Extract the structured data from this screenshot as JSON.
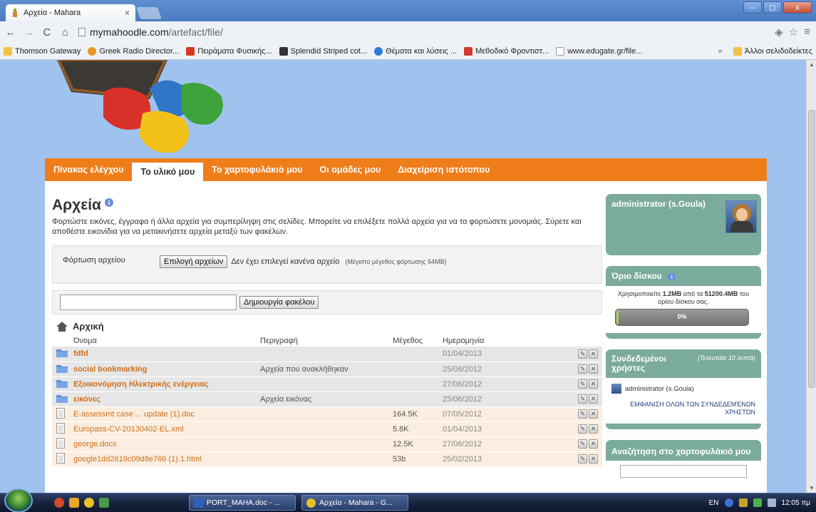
{
  "browser": {
    "tab_title": "Αρχεία - Mahara",
    "tab_close": "×",
    "url_host": "mymahoodle.com",
    "url_path": "/artefact/file/",
    "window_buttons": [
      "–",
      "◻",
      "x"
    ],
    "bookmarks": [
      {
        "label": "Thomson Gateway",
        "icon": "folder-icon",
        "color": "#f1c243"
      },
      {
        "label": "Greek Radio Director...",
        "icon": "radio-icon",
        "color": "#e8981f"
      },
      {
        "label": "Πειράματα Φυσικής...",
        "icon": "physics-icon",
        "color": "#d7381b"
      },
      {
        "label": "Splendid Striped cot...",
        "icon": "p-icon",
        "color": "#333333"
      },
      {
        "label": "Θέματα και λύσεις ...",
        "icon": "globe-icon",
        "color": "#2a7bd6"
      },
      {
        "label": "Μεθοδικό Φροντιστ...",
        "icon": "m-icon",
        "color": "#d43a2c"
      },
      {
        "label": "www.edugate.gr/file...",
        "icon": "page-icon",
        "color": "#ffffff"
      }
    ],
    "bookmarks_overflow": "»",
    "other_bookmarks": "Άλλοι σελιδοδείκτες"
  },
  "nav": {
    "items": [
      {
        "label": "Πίνακας ελέγχου",
        "active": false
      },
      {
        "label": "Το υλικό μου",
        "active": true
      },
      {
        "label": "Το χαρτοφυλάκιό μου",
        "active": false
      },
      {
        "label": "Οι ομάδες μου",
        "active": false
      },
      {
        "label": "Διαχείριση ιστότοπου",
        "active": false
      }
    ]
  },
  "main": {
    "title": "Αρχεία",
    "info": "i",
    "description": "Φορτώστε εικόνες, έγγραφα ή άλλα αρχεία για συμπερίληψη στις σελίδες. Μπορείτε να επιλέξετε πολλά αρχεία για να τα φορτώσετε μονομιάς. Σύρετε και αποθέστε εικονίδια για να μετακινήσετε αρχεία μεταξύ των φακέλων.",
    "upload_label": "Φόρτωση αρχείου",
    "choose_files": "Επιλογή αρχείων",
    "no_file": "Δεν έχει επιλεγεί κανένα αρχείο",
    "max_size": "(Μέγιστο μέγεθος φόρτωσης 64MB)",
    "folder_input": "",
    "create_folder": "Δημιουργία φακέλου",
    "breadcrumb": "Αρχική",
    "columns": {
      "name": "Όνομα",
      "description": "Περιγραφή",
      "size": "Μέγεθος",
      "date": "Ημερομηνία"
    },
    "files": [
      {
        "type": "folder",
        "name": "fdfd",
        "description": "",
        "size": "",
        "date": "01/04/2013"
      },
      {
        "type": "folder",
        "name": "social bookmarking",
        "description": "Αρχεία που ανακλήθηκαν",
        "size": "",
        "date": "25/06/2012"
      },
      {
        "type": "folder",
        "name": "Εξοικονόμηση Ηλεκτρικής ενέργειας",
        "description": "",
        "size": "",
        "date": "27/06/2012"
      },
      {
        "type": "folder",
        "name": "εικόνες",
        "description": "Αρχεία εικόνας",
        "size": "",
        "date": "25/06/2012"
      },
      {
        "type": "file",
        "name": "E-assessmt case ... update (1).doc",
        "description": "",
        "size": "164.5K",
        "date": "07/05/2012"
      },
      {
        "type": "file",
        "name": "Europass-CV-20130402-EL.xml",
        "description": "",
        "size": "5.8K",
        "date": "01/04/2013"
      },
      {
        "type": "file",
        "name": "george.docx",
        "description": "",
        "size": "12.5K",
        "date": "27/06/2012"
      },
      {
        "type": "file",
        "name": "google1dd2619c09d8e766 (1).1.html",
        "description": "",
        "size": "53b",
        "date": "25/02/2013"
      }
    ],
    "edit_glyph": "✎",
    "delete_glyph": "✕"
  },
  "sidebar": {
    "profile_name": "administrator (s.Goula)",
    "quota_title": "Όριο δίσκου",
    "quota_text_prefix": "Χρησιμοποιείτε ",
    "quota_used": "1.2MB",
    "quota_middle": " από τα ",
    "quota_total": "51200.4MB",
    "quota_suffix": " του ορίου δίσκου σας.",
    "quota_percent": "0%",
    "quota_fraction": 0.0,
    "online_title": "Συνδεδεμένοι χρήστες",
    "online_note": "(Τελευταία 10 λεπτά)",
    "online_user": "administrator (s.Goula)",
    "show_all": "ΕΜΦΑΝΙΣΗ ΟΛΩΝ ΤΩΝ ΣΥΝΔΕΔΕΜΈΝΩΝ ΧΡΗΣΤΏΝ",
    "search_title": "Αναζήτηση στο χαρτοφυλάκιό μου"
  },
  "taskbar": {
    "tasks": [
      "PORT_MAHA.doc - ...",
      "Αρχεία - Mahara - G..."
    ],
    "lang": "EN",
    "time": "12:05 πμ"
  }
}
